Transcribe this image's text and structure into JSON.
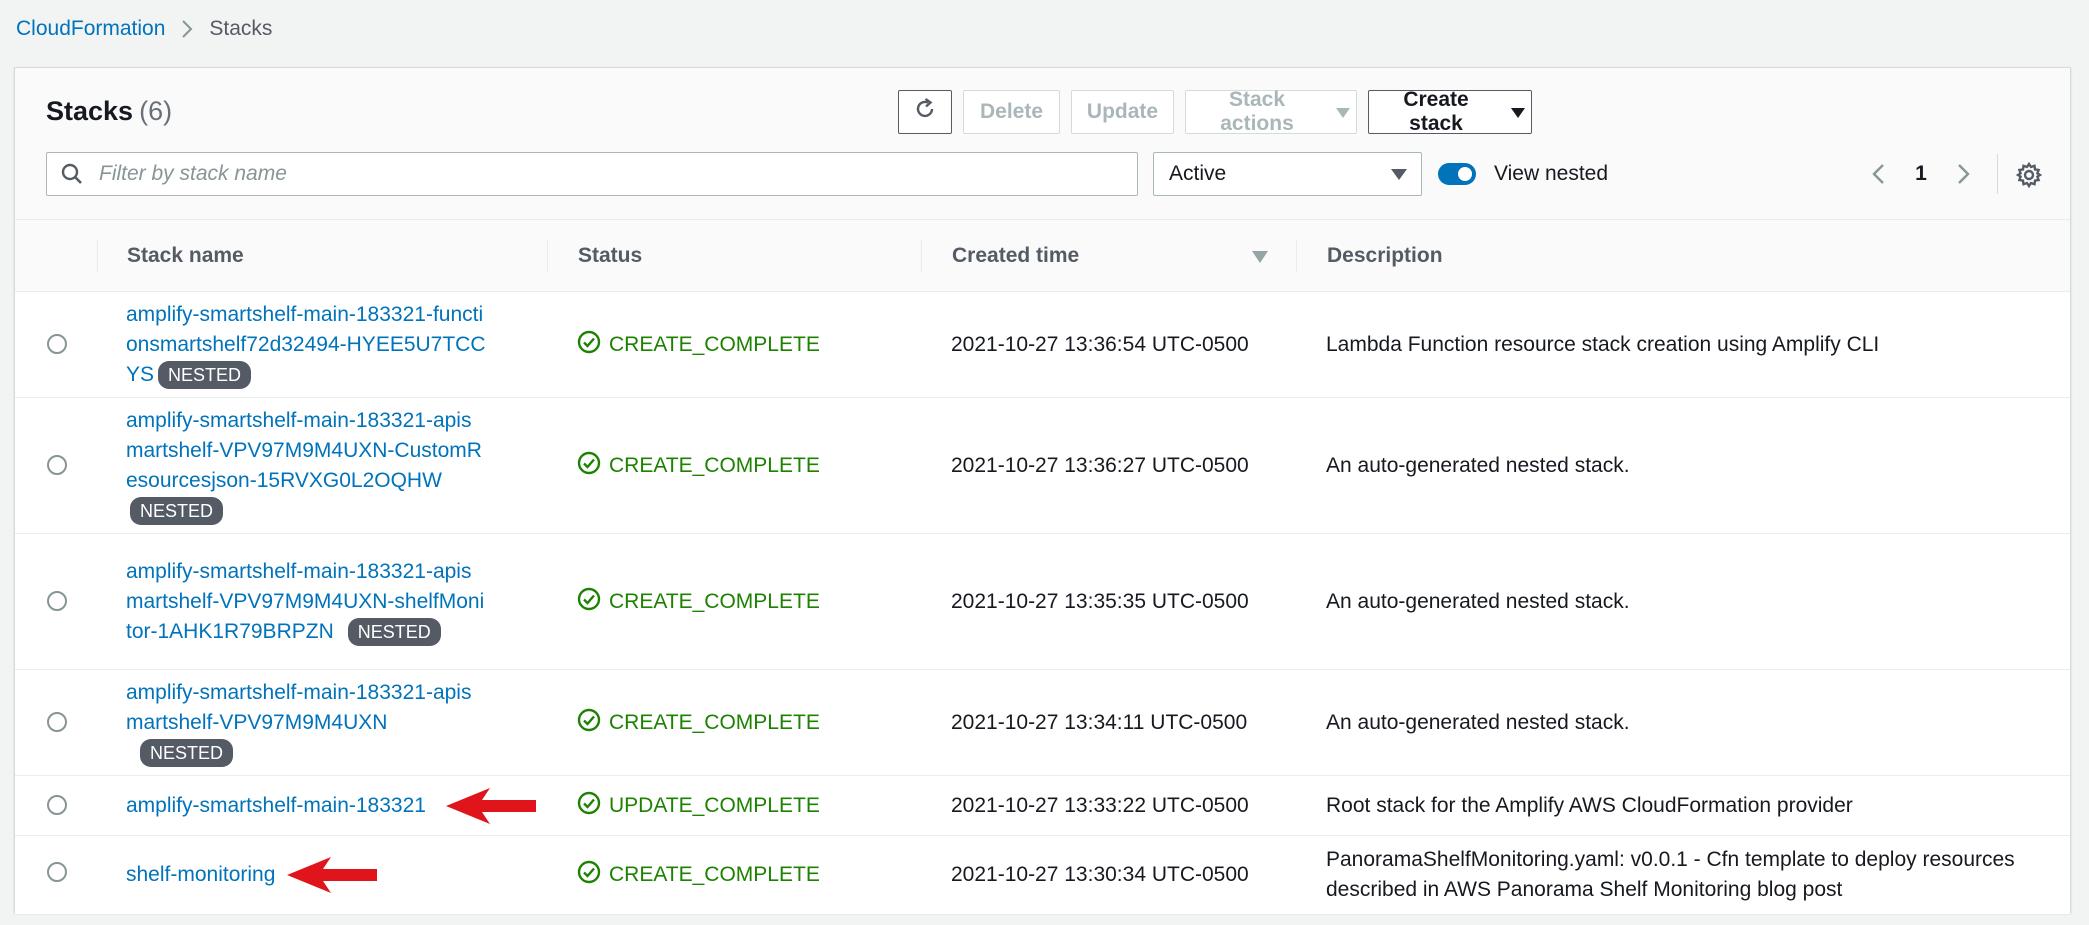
{
  "breadcrumb": {
    "root": "CloudFormation",
    "current": "Stacks"
  },
  "header": {
    "title": "Stacks",
    "count": "(6)",
    "buttons": {
      "delete": "Delete",
      "update": "Update",
      "stack_actions": "Stack actions",
      "create_stack": "Create stack"
    }
  },
  "filter": {
    "placeholder": "Filter by stack name",
    "status_select": "Active",
    "view_nested_label": "View nested",
    "view_nested_on": true
  },
  "pagination": {
    "page": "1"
  },
  "table": {
    "columns": {
      "name": "Stack name",
      "status": "Status",
      "created": "Created time",
      "description": "Description"
    },
    "rows": [
      {
        "name": "amplify-smartshelf-main-183321-functionsmartshelf72d32494-HYEE5U7TCCYS",
        "badge": "NESTED",
        "status": "CREATE_COMPLETE",
        "created": "2021-10-27 13:36:54 UTC-0500",
        "description": "Lambda Function resource stack creation using Amplify CLI"
      },
      {
        "name": "amplify-smartshelf-main-183321-apismartshelf-VPV97M9M4UXN-CustomResourcesjson-15RVXG0L2OQHW",
        "badge": "NESTED",
        "status": "CREATE_COMPLETE",
        "created": "2021-10-27 13:36:27 UTC-0500",
        "description": "An auto-generated nested stack."
      },
      {
        "name": "amplify-smartshelf-main-183321-apismartshelf-VPV97M9M4UXN-shelfMonitor-1AHK1R79BRPZN",
        "badge": "NESTED",
        "status": "CREATE_COMPLETE",
        "created": "2021-10-27 13:35:35 UTC-0500",
        "description": "An auto-generated nested stack."
      },
      {
        "name": "amplify-smartshelf-main-183321-apismartshelf-VPV97M9M4UXN",
        "badge": "NESTED",
        "status": "CREATE_COMPLETE",
        "created": "2021-10-27 13:34:11 UTC-0500",
        "description": "An auto-generated nested stack."
      },
      {
        "name": "amplify-smartshelf-main-183321",
        "badge": "",
        "status": "UPDATE_COMPLETE",
        "created": "2021-10-27 13:33:22 UTC-0500",
        "description": "Root stack for the Amplify AWS CloudFormation provider"
      },
      {
        "name": "shelf-monitoring",
        "badge": "",
        "status": "CREATE_COMPLETE",
        "created": "2021-10-27 13:30:34 UTC-0500",
        "description": "PanoramaShelfMonitoring.yaml: v0.0.1 - Cfn template to deploy resources described in AWS Panorama Shelf Monitoring blog post"
      }
    ]
  },
  "colors": {
    "link": "#0073bb",
    "success": "#1d8102",
    "annotation_arrow": "#e0151b"
  }
}
